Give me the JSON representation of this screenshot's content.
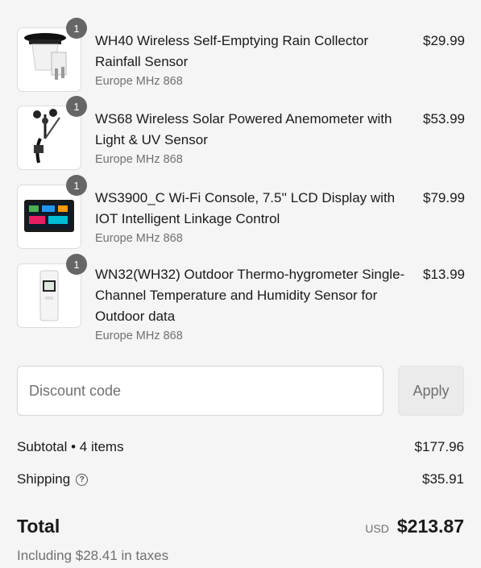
{
  "line_items": [
    {
      "qty": "1",
      "name": "WH40 Wireless Self-Emptying Rain Collector Rainfall Sensor",
      "variant": "Europe MHz 868",
      "price": "$29.99",
      "image_icon": "rain-collector-icon"
    },
    {
      "qty": "1",
      "name": "WS68 Wireless Solar Powered Anemometer with Light & UV Sensor",
      "variant": "Europe MHz 868",
      "price": "$53.99",
      "image_icon": "anemometer-icon"
    },
    {
      "qty": "1",
      "name": "WS3900_C Wi-Fi Console, 7.5'' LCD Display with IOT Intelligent Linkage Control",
      "variant": "Europe MHz 868",
      "price": "$79.99",
      "image_icon": "console-icon"
    },
    {
      "qty": "1",
      "name": "WN32(WH32) Outdoor Thermo-hygrometer Single-Channel Temperature and Humidity Sensor for Outdoor data",
      "variant": "Europe MHz 868",
      "price": "$13.99",
      "image_icon": "thermo-hygrometer-icon"
    }
  ],
  "discount": {
    "placeholder": "Discount code",
    "value": "",
    "apply_label": "Apply"
  },
  "summary": {
    "subtotal_label": "Subtotal • 4 items",
    "subtotal_value": "$177.96",
    "shipping_label": "Shipping",
    "shipping_value": "$35.91",
    "total_label": "Total",
    "currency": "USD",
    "total_value": "$213.87",
    "taxes_note": "Including $28.41 in taxes"
  },
  "colors": {
    "background": "#f5f5f5",
    "badge": "#666666",
    "muted_text": "#707070"
  }
}
